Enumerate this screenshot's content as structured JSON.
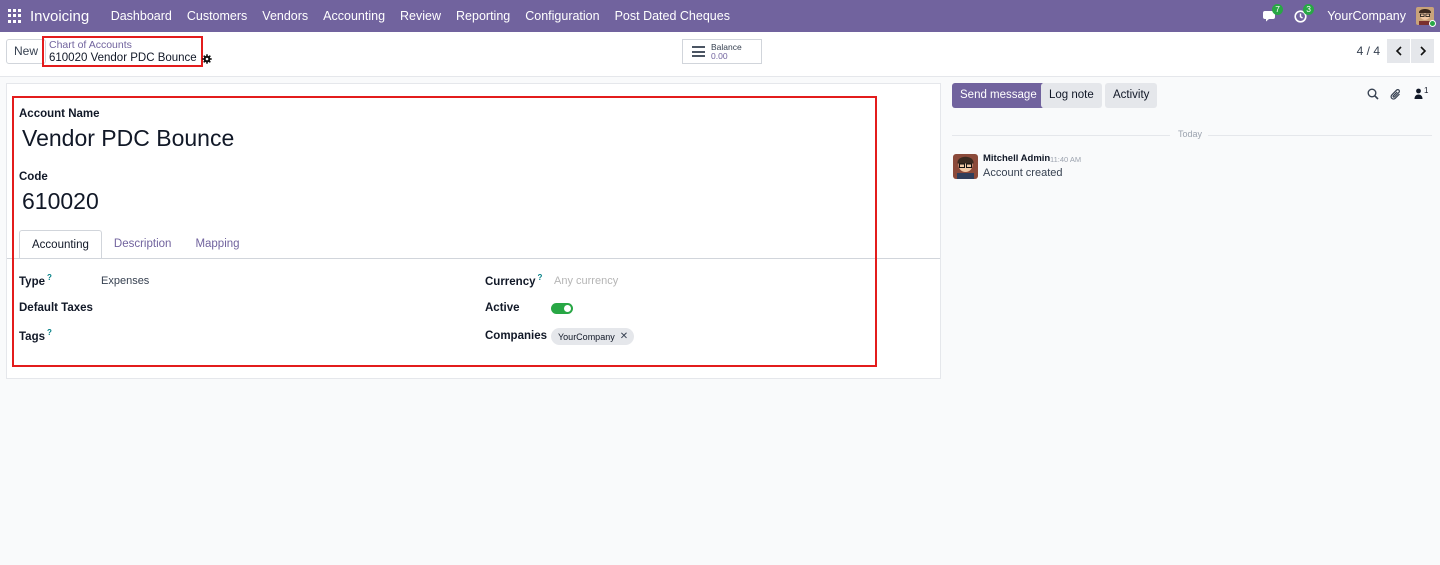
{
  "navbar": {
    "app_name": "Invoicing",
    "menu": [
      "Dashboard",
      "Customers",
      "Vendors",
      "Accounting",
      "Review",
      "Reporting",
      "Configuration",
      "Post Dated Cheques"
    ],
    "messages_count": "7",
    "activities_count": "3",
    "company": "YourCompany"
  },
  "control_panel": {
    "new_label": "New",
    "breadcrumb_parent": "Chart of Accounts",
    "breadcrumb_current": "610020 Vendor PDC Bounce",
    "smart_button": {
      "label": "Balance",
      "value": "0.00"
    },
    "pager": "4 / 4"
  },
  "form": {
    "account_name_label": "Account Name",
    "account_name": "Vendor PDC Bounce",
    "code_label": "Code",
    "code": "610020",
    "tabs": [
      "Accounting",
      "Description",
      "Mapping"
    ],
    "active_tab": "Accounting",
    "type_label": "Type",
    "type_value": "Expenses",
    "default_taxes_label": "Default Taxes",
    "tags_label": "Tags",
    "currency_label": "Currency",
    "currency_placeholder": "Any currency",
    "active_label": "Active",
    "active": true,
    "companies_label": "Companies",
    "companies": [
      "YourCompany"
    ],
    "help_mark": "?"
  },
  "chatter": {
    "send_message": "Send message",
    "log_note": "Log note",
    "activity": "Activity",
    "followers_count": "1",
    "date_separator": "Today",
    "messages": [
      {
        "author": "Mitchell Admin",
        "time": "11:40 AM",
        "body": "Account created"
      }
    ]
  },
  "colors": {
    "brand": "#71639e",
    "highlight": "#e31c1c",
    "toggle_on": "#28a745"
  }
}
